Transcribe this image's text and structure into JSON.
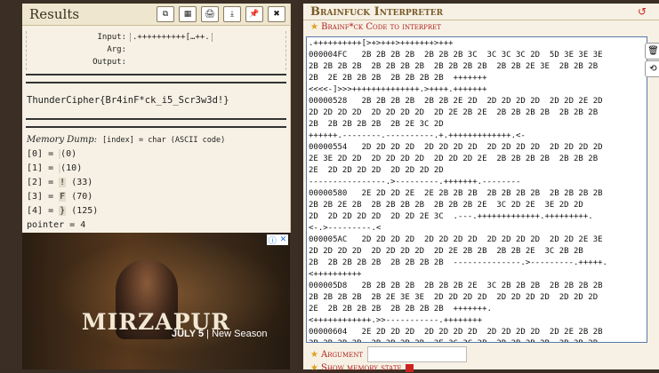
{
  "results": {
    "title": "Results",
    "toolbar": [
      "⧉",
      "▦",
      "🖨",
      "⤓",
      "📌",
      "✖"
    ],
    "input_label": "Input:",
    "input_value": ".++++++++++[…++.",
    "arg_label": "Arg:",
    "arg_value": "",
    "output_label": "Output:",
    "output_value": "",
    "decoded": "ThunderCipher{Br4inF*ck_i5_Scr3w3d!}",
    "memdump_title": "Memory Dump:",
    "memdump_desc": "[index] = char (ASCII code)",
    "cells": [
      {
        "index": "[0] =",
        "char": "",
        "code": "(0)"
      },
      {
        "index": "[1] =",
        "char": "",
        "code": "(10)"
      },
      {
        "index": "[2] =",
        "char": "!",
        "code": "(33)"
      },
      {
        "index": "[3] =",
        "char": "F",
        "code": "(70)"
      },
      {
        "index": "[4] =",
        "char": "}",
        "code": "(125)"
      }
    ],
    "pointer": "pointer = 4"
  },
  "ad": {
    "title": "MIRZAPUR",
    "date": "JULY 5",
    "sub": "| New Season",
    "info_icon": "ⓘ",
    "close_icon": "✕"
  },
  "interpreter": {
    "title": "Brainfuck Interpreter",
    "refresh_icon": "↺",
    "code_label": "Brainf*ck Code to interpret",
    "code": ".++++++++++[>+>+++>+++++++>+++\n000004FC   2B 2B 2B 2B  2B 2B 2B 3C  3C 3C 3C 2D  5D 3E 3E 3E\n2B 2B 2B 2B  2B 2B 2B 2B  2B 2B 2B 2B  2B 2B 2E 3E  2B 2B 2B\n2B  2E 2B 2B 2B  2B 2B 2B 2B  +++++++\n<<<<-]>>>++++++++++++++.>++++.+++++++\n00000528   2B 2B 2B 2B  2B 2B 2E 2D  2D 2D 2D 2D  2D 2D 2E 2D\n2D 2D 2D 2D  2D 2D 2D 2D  2D 2E 2B 2E  2B 2B 2B 2B  2B 2B 2B\n2B  2B 2B 2B 2B  2B 2E 3C 2D\n++++++.--------.----------.+.+++++++++++++.<-\n00000554   2D 2D 2D 2D  2D 2D 2D 2D  2D 2D 2D 2D  2D 2D 2D 2D\n2E 3E 2D 2D  2D 2D 2D 2D  2D 2D 2D 2E  2B 2B 2B 2B  2B 2B 2B\n2E  2D 2D 2D 2D  2D 2D 2D 2D\n----------------.>---------.+++++++.--------\n00000580   2E 2D 2D 2E  2E 2B 2B 2B  2B 2B 2B 2B  2B 2B 2B 2B\n2B 2B 2E 2B  2B 2B 2B 2B  2B 2B 2B 2E  3C 2D 2E  3E 2D 2D\n2D  2D 2D 2D 2D  2D 2D 2E 3C  .---.+++++++++++++.+++++++++.\n<-.>---------.<\n000005AC   2D 2D 2D 2D  2D 2D 2D 2D  2D 2D 2D 2D  2D 2D 2E 3E\n2D 2D 2D 2D  2D 2D 2D 2D  2D 2E 2B 2B  2B 2B 2E  3C 2B 2B\n2B  2B 2B 2B 2B  2B 2B 2B 2B  --------------.>---------.+++++.\n<++++++++++\n000005D8   2B 2B 2B 2B  2B 2B 2B 2E  3C 2B 2B 2B  2B 2B 2B 2B\n2B 2B 2B 2B  2B 2E 3E 3E  2D 2D 2D 2D  2D 2D 2D 2D  2D 2D 2D\n2E  2B 2B 2B 2B  2B 2B 2B 2B  +++++++.\n<++++++++++++.>>-----------.++++++++\n00000604   2E 2D 2D 2D  2D 2D 2D 2D  2D 2D 2D 2D  2D 2E 2B 2B\n2B 2B 2B 2B  2B 2B 2B 2B  2E 3C 3C 2B  2B 2B 2B 2B  2B 2B 2B",
    "side_buttons": [
      "🗑",
      "⟲"
    ],
    "argument_label": "Argument",
    "argument_value": "",
    "memory_label": "Show memory state"
  }
}
